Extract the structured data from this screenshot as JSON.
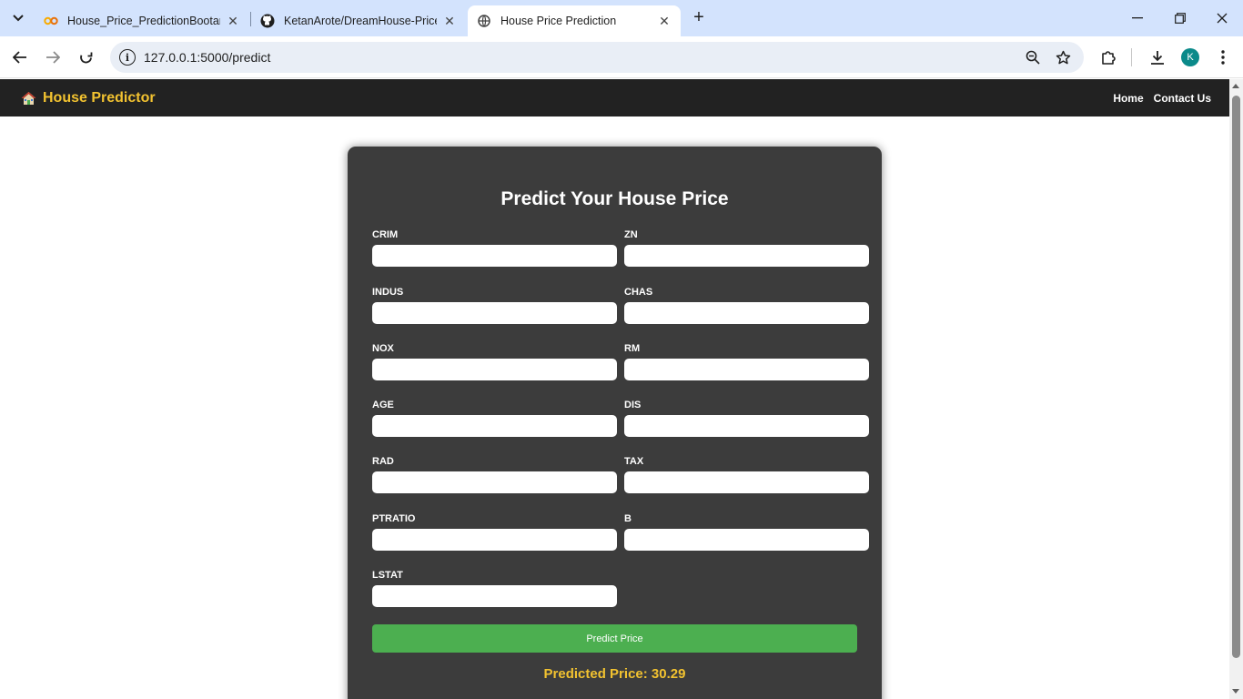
{
  "browser": {
    "tabs": [
      {
        "title": "House_Price_PredictionBootamp",
        "active": false
      },
      {
        "title": "KetanArote/DreamHouse-Price-",
        "active": false
      },
      {
        "title": "House Price Prediction",
        "active": true
      }
    ],
    "url": "127.0.0.1:5000/predict",
    "profile_initial": "K"
  },
  "site": {
    "brand": "House Predictor",
    "nav": [
      {
        "label": "Home"
      },
      {
        "label": "Contact Us"
      }
    ]
  },
  "form": {
    "title": "Predict Your House Price",
    "fields": [
      {
        "label": "CRIM",
        "value": ""
      },
      {
        "label": "ZN",
        "value": ""
      },
      {
        "label": "INDUS",
        "value": ""
      },
      {
        "label": "CHAS",
        "value": ""
      },
      {
        "label": "NOX",
        "value": ""
      },
      {
        "label": "RM",
        "value": ""
      },
      {
        "label": "AGE",
        "value": ""
      },
      {
        "label": "DIS",
        "value": ""
      },
      {
        "label": "RAD",
        "value": ""
      },
      {
        "label": "TAX",
        "value": ""
      },
      {
        "label": "PTRATIO",
        "value": ""
      },
      {
        "label": "B",
        "value": ""
      },
      {
        "label": "LSTAT",
        "value": ""
      }
    ],
    "submit_label": "Predict Price",
    "result": "Predicted Price: 30.29"
  },
  "colors": {
    "brand": "#f2c230",
    "navbar": "#222222",
    "card": "#3c3c3c",
    "button": "#4caf50",
    "result": "#f2c230"
  }
}
